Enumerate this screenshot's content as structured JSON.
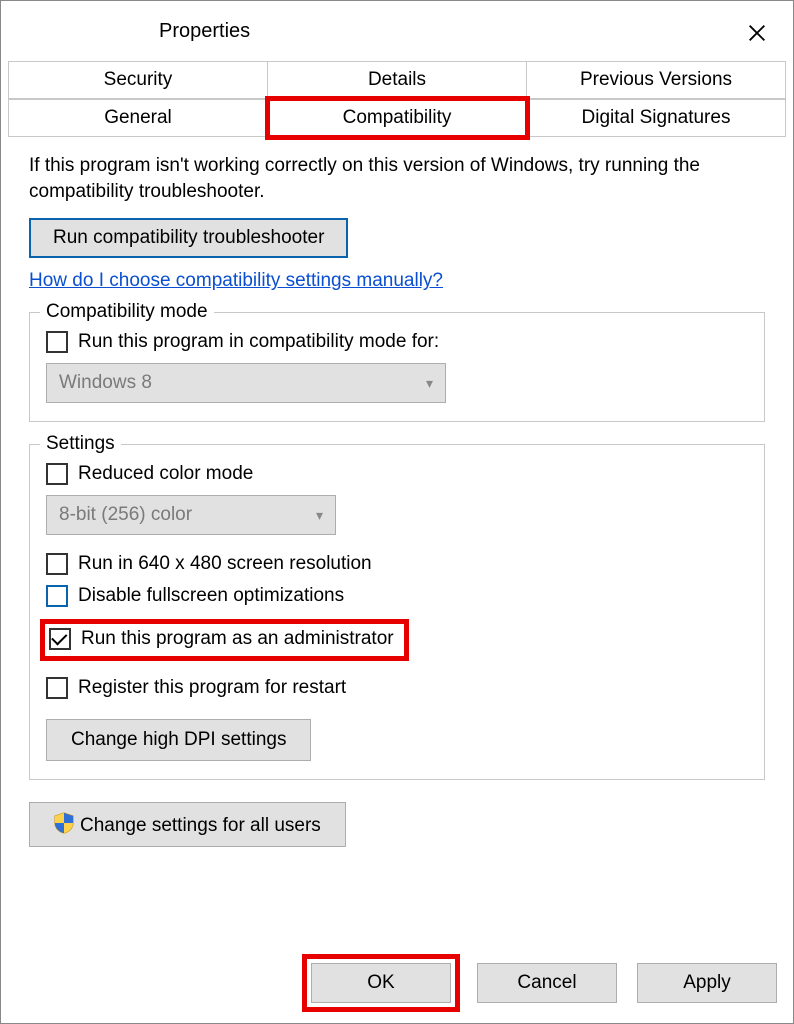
{
  "window": {
    "title": "Properties"
  },
  "tabs": {
    "row1": [
      "Security",
      "Details",
      "Previous Versions"
    ],
    "row2": [
      "General",
      "Compatibility",
      "Digital Signatures"
    ],
    "active": "Compatibility"
  },
  "intro": "If this program isn't working correctly on this version of Windows, try running the compatibility troubleshooter.",
  "troubleshooter_btn": "Run compatibility troubleshooter",
  "help_link": "How do I choose compatibility settings manually?",
  "compat_mode": {
    "legend": "Compatibility mode",
    "checkbox_label": "Run this program in compatibility mode for:",
    "checked": false,
    "dropdown_value": "Windows 8"
  },
  "settings": {
    "legend": "Settings",
    "reduced_color": {
      "label": "Reduced color mode",
      "checked": false
    },
    "color_dropdown": "8-bit (256) color",
    "run_640": {
      "label": "Run in 640 x 480 screen resolution",
      "checked": false
    },
    "disable_fullscreen": {
      "label": "Disable fullscreen optimizations",
      "checked": false
    },
    "run_admin": {
      "label": "Run this program as an administrator",
      "checked": true
    },
    "register_restart": {
      "label": "Register this program for restart",
      "checked": false
    },
    "dpi_btn": "Change high DPI settings"
  },
  "all_users_btn": "Change settings for all users",
  "footer": {
    "ok": "OK",
    "cancel": "Cancel",
    "apply": "Apply"
  }
}
